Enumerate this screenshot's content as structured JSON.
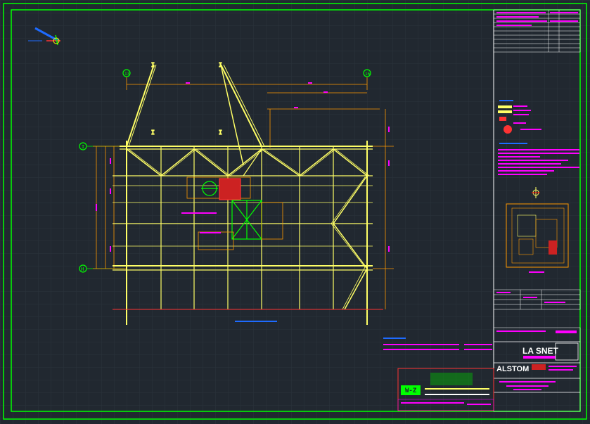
{
  "colors": {
    "background": "#212830",
    "grid": "#2b333c",
    "frame": "#00ff00",
    "structure": "#ffff66",
    "dims": "#ff9900",
    "text": "#ff00ff",
    "accent": "#ff3333",
    "blue": "#1e6bff",
    "cyan": "#00ffff",
    "white": "#ffffff"
  },
  "icons": {
    "ucs": "ucs-axis-icon",
    "north": "north-arrow-icon"
  },
  "grid_labels": {
    "col_left": "13",
    "col_right": "16",
    "row_top": "I",
    "row_bottom": "H"
  },
  "titleblock": {
    "company_site": "LA SNET",
    "brand": "ALSTOM",
    "wf": "W-Z"
  }
}
